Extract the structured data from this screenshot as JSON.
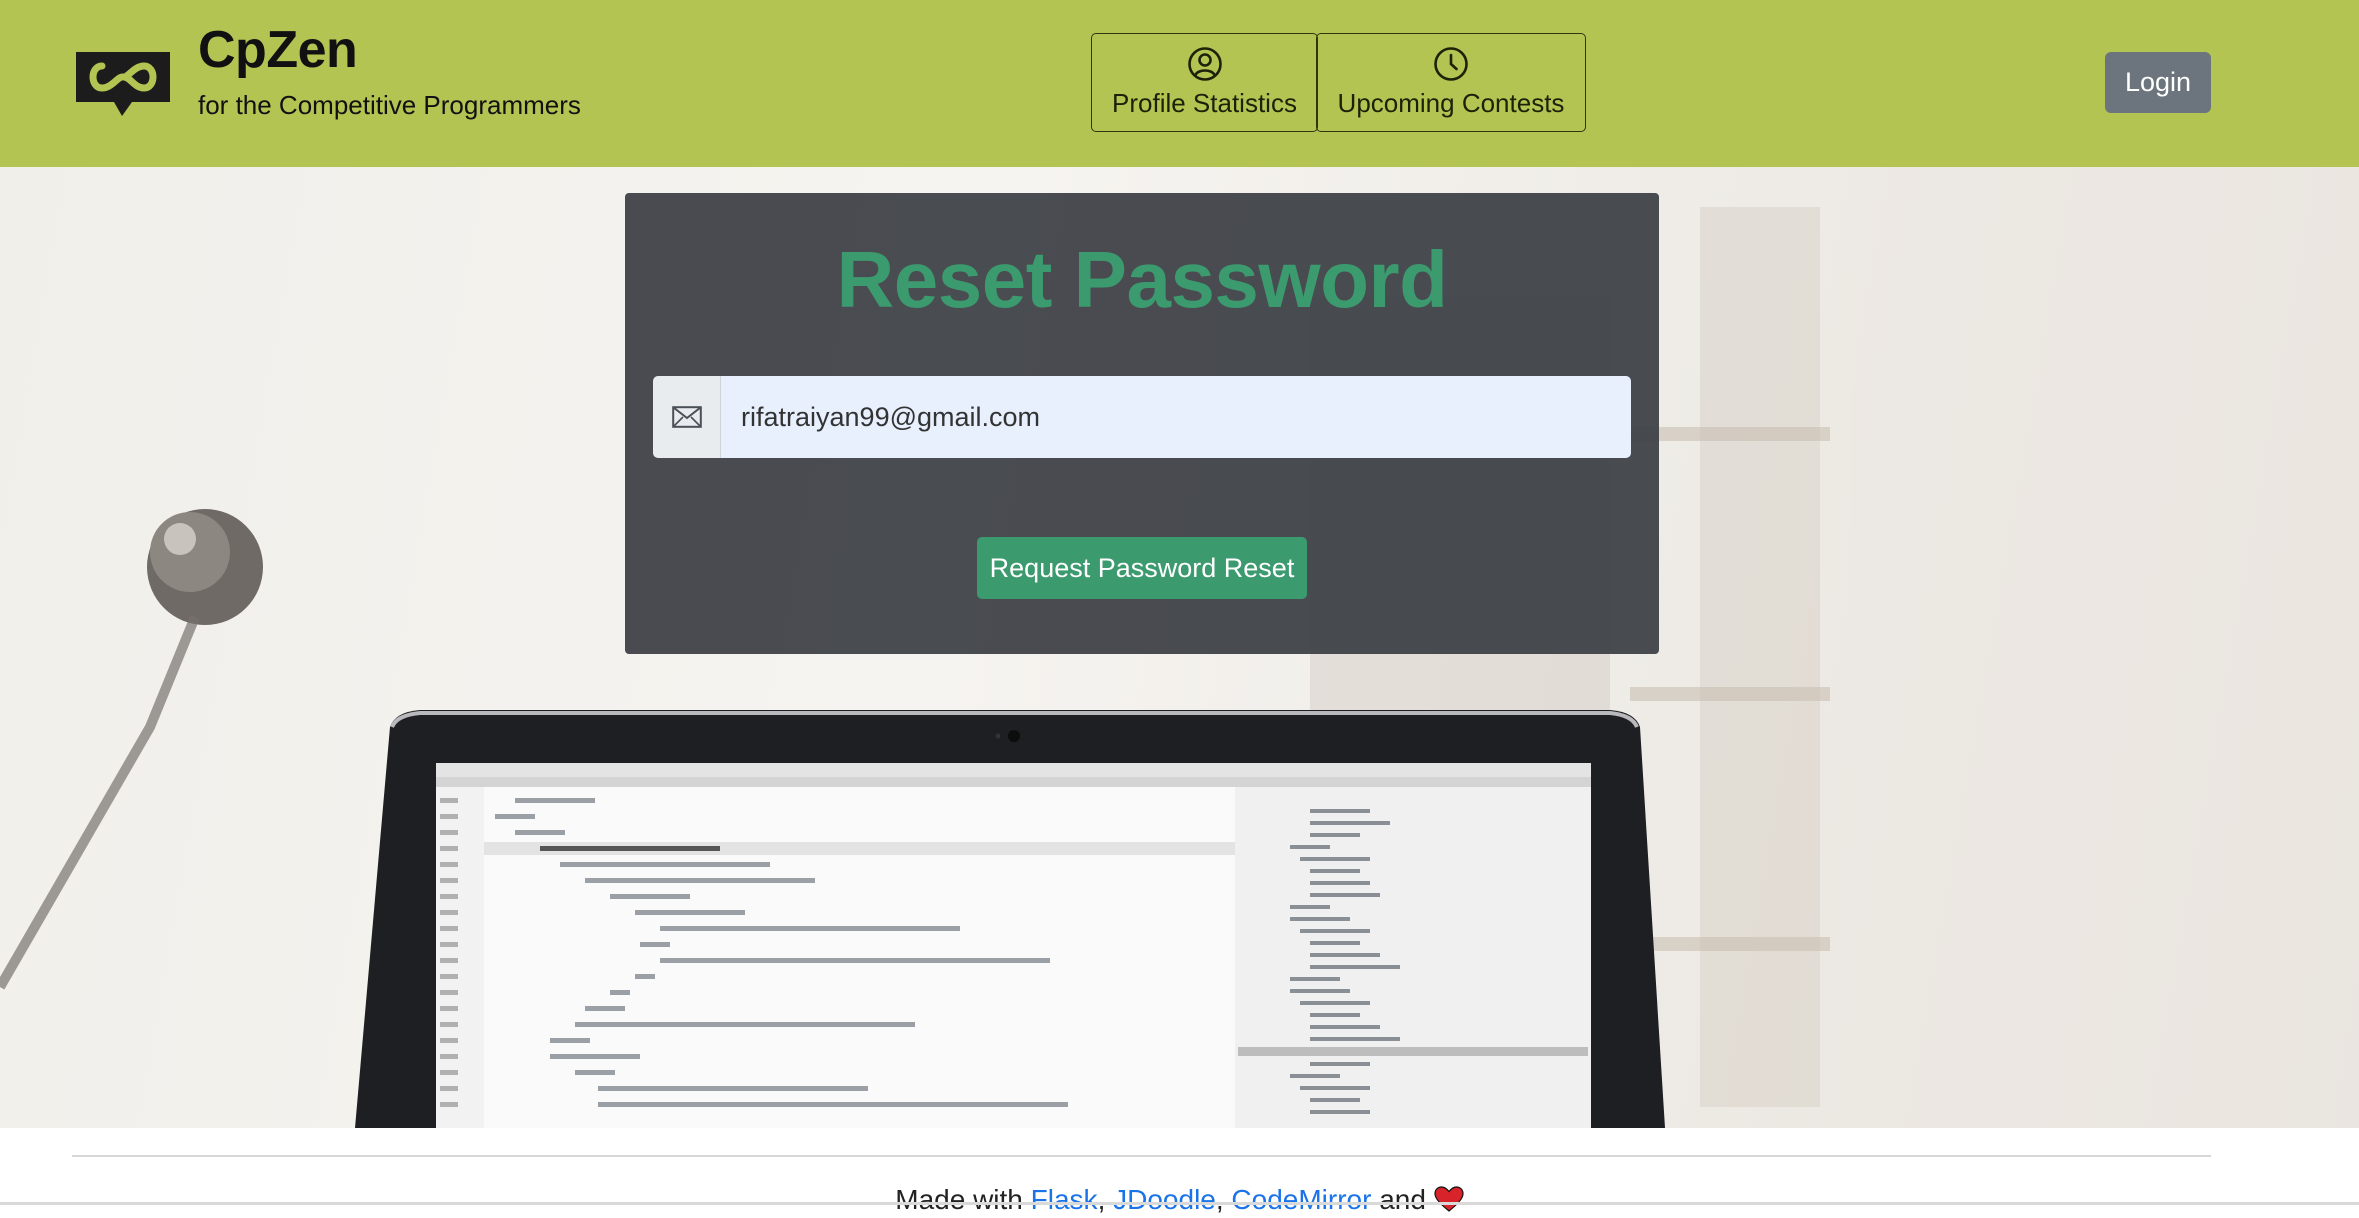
{
  "header": {
    "brand_title": "CpZen",
    "brand_tagline": "for the Competitive Programmers",
    "logo_icon": "infinity-speech-bubble-icon",
    "nav": [
      {
        "label": "Profile Statistics",
        "icon": "user-circle-icon"
      },
      {
        "label": "Upcoming Contests",
        "icon": "clock-icon"
      }
    ],
    "login_label": "Login",
    "colors": {
      "bar": "#b3c453",
      "login": "#6c757d"
    }
  },
  "form": {
    "title": "Reset Password",
    "email_icon": "envelope-icon",
    "email_value": "rifatraiyan99@gmail.com",
    "submit_label": "Request Password Reset",
    "colors": {
      "accent": "#3c9a6f",
      "card": "#3a3d42"
    }
  },
  "footer": {
    "prefix": "Made with",
    "links": [
      "Flask",
      "JDoodle",
      "CodeMirror"
    ],
    "and": "and",
    "heart_icon": "heart-icon"
  }
}
